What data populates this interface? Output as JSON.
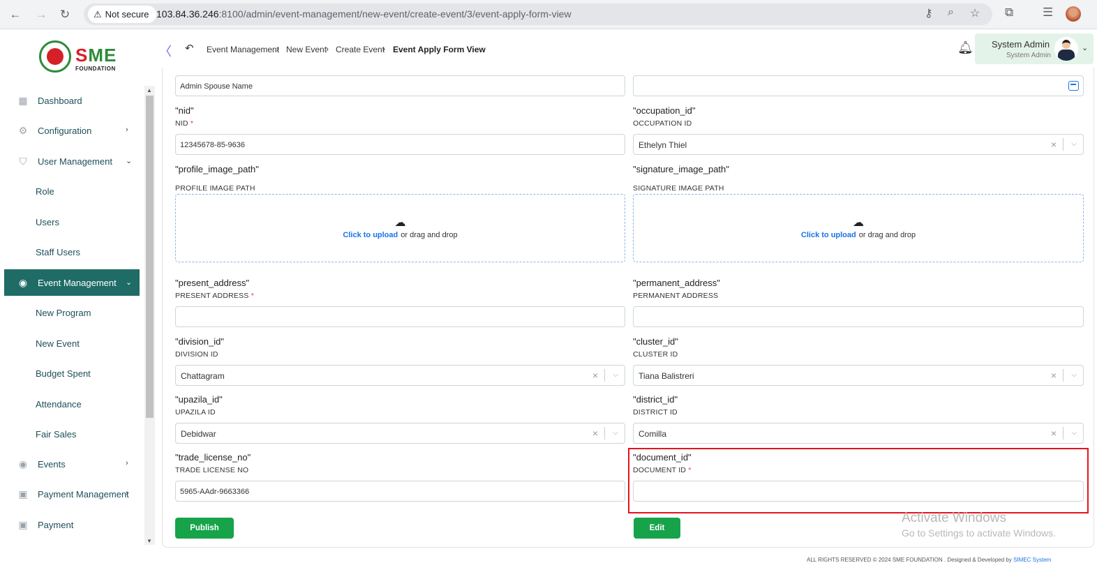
{
  "browser": {
    "not_secure": "Not secure",
    "url_host": "103.84.36.246",
    "url_rest": ":8100/admin/event-management/new-event/create-event/3/event-apply-form-view"
  },
  "logo": {
    "text_s": "S",
    "text_me": "ME",
    "foundation": "FOUNDATION"
  },
  "sidebar": {
    "items": [
      {
        "label": "Dashboard",
        "icon": "grid-icon"
      },
      {
        "label": "Configuration",
        "icon": "config-icon"
      },
      {
        "label": "User Management",
        "icon": "shield-icon"
      },
      {
        "label": "Event Management",
        "icon": "lock-icon"
      },
      {
        "label": "Events",
        "icon": "lock-icon"
      },
      {
        "label": "Payment Management",
        "icon": "payment-icon"
      },
      {
        "label": "Payment",
        "icon": "payment-icon"
      }
    ],
    "user_sub": [
      "Role",
      "Users",
      "Staff Users"
    ],
    "event_sub": [
      "New Program",
      "New Event",
      "Budget Spent",
      "Attendance",
      "Fair Sales"
    ]
  },
  "header": {
    "breadcrumbs": [
      "Event Management",
      "New Event",
      "Create Event",
      "Event Apply Form View"
    ],
    "user_name": "System Admin",
    "user_role": "System Admin"
  },
  "form": {
    "spouse_value": "Admin Spouse Name",
    "nid_key": "\"nid\"",
    "nid_label": "NID",
    "nid_value": "12345678-85-9636",
    "occupation_key": "\"occupation_id\"",
    "occupation_label": "OCCUPATION ID",
    "occupation_value": "Ethelyn Thiel",
    "profile_key": "\"profile_image_path\"",
    "profile_label": "PROFILE IMAGE PATH",
    "signature_key": "\"signature_image_path\"",
    "signature_label": "SIGNATURE IMAGE PATH",
    "upload_link": "Click to upload",
    "upload_rest": "or drag and drop",
    "present_key": "\"present_address\"",
    "present_label": "PRESENT ADDRESS",
    "permanent_key": "\"permanent_address\"",
    "permanent_label": "PERMANENT ADDRESS",
    "division_key": "\"division_id\"",
    "division_label": "DIVISION ID",
    "division_value": "Chattagram",
    "cluster_key": "\"cluster_id\"",
    "cluster_label": "CLUSTER ID",
    "cluster_value": "Tiana Balistreri",
    "upazila_key": "\"upazila_id\"",
    "upazila_label": "UPAZILA ID",
    "upazila_value": "Debidwar",
    "district_key": "\"district_id\"",
    "district_label": "DISTRICT ID",
    "district_value": "Comilla",
    "trade_key": "\"trade_license_no\"",
    "trade_label": "TRADE LICENSE NO",
    "trade_value": "5965-AAdr-9663366",
    "document_key": "\"document_id\"",
    "document_label": "DOCUMENT ID",
    "required": "*"
  },
  "buttons": {
    "publish": "Publish",
    "edit": "Edit"
  },
  "watermark": {
    "line1": "Activate Windows",
    "line2": "Go to Settings to activate Windows."
  },
  "footer": {
    "text": "ALL RIGHTS RESERVED © 2024 SME FOUNDATION . Designed & Developed by",
    "link": "SIMEC System"
  }
}
